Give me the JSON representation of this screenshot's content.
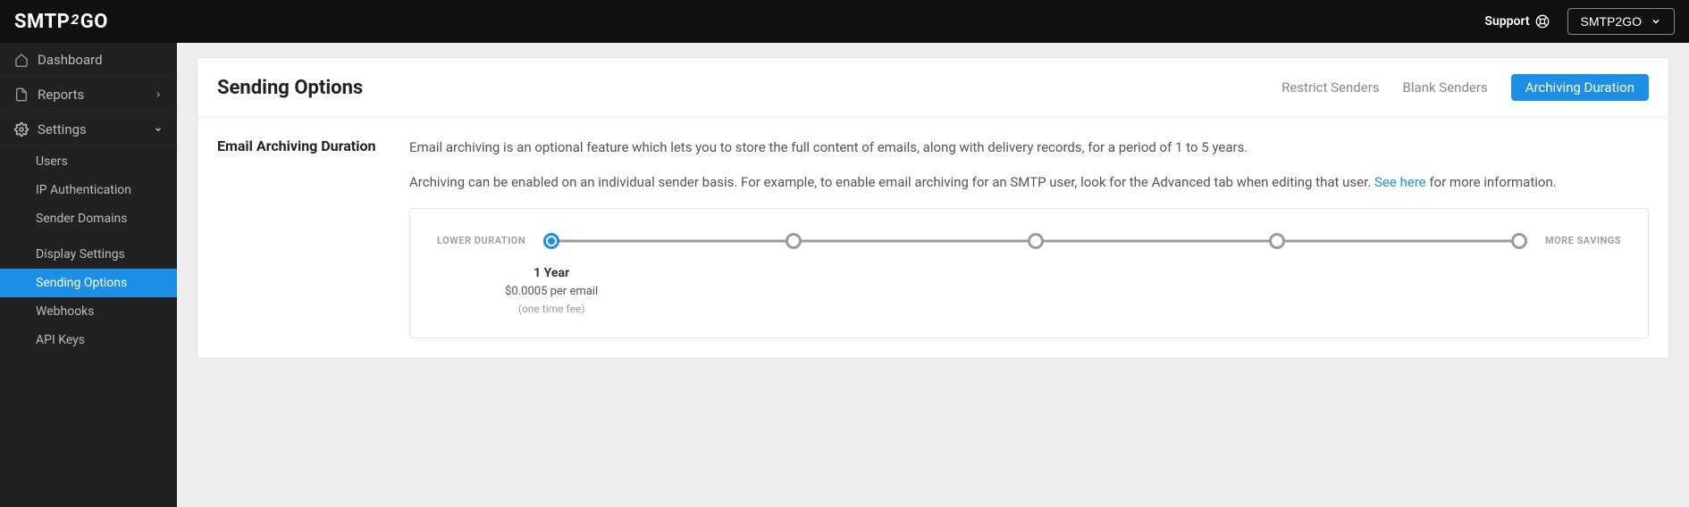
{
  "header": {
    "logo_prefix": "SMTP",
    "logo_mid": "2",
    "logo_suffix": "GO",
    "support_label": "Support",
    "account_label": "SMTP2GO"
  },
  "sidebar": {
    "items": [
      {
        "label": "Dashboard"
      },
      {
        "label": "Reports"
      },
      {
        "label": "Settings"
      }
    ],
    "settings_children_group1": [
      {
        "label": "Users"
      },
      {
        "label": "IP Authentication"
      },
      {
        "label": "Sender Domains"
      }
    ],
    "settings_children_group2": [
      {
        "label": "Display Settings"
      },
      {
        "label": "Sending Options"
      },
      {
        "label": "Webhooks"
      },
      {
        "label": "API Keys"
      }
    ]
  },
  "page": {
    "title": "Sending Options",
    "tabs": [
      {
        "label": "Restrict Senders"
      },
      {
        "label": "Blank Senders"
      },
      {
        "label": "Archiving Duration"
      }
    ],
    "section_title": "Email Archiving Duration",
    "desc1": "Email archiving is an optional feature which lets you to store the full content of emails, along with delivery records, for a period of 1 to 5 years.",
    "desc2_a": "Archiving can be enabled on an individual sender basis. For example, to enable email archiving for an SMTP user, look for the Advanced tab when editing that user. ",
    "desc2_link": "See here",
    "desc2_b": " for more information.",
    "slider": {
      "left_label": "LOWER DURATION",
      "right_label": "MORE SAVINGS",
      "num_stops": 5,
      "selected_index": 0,
      "value_title": "1 Year",
      "value_sub": "$0.0005 per email",
      "value_note": "(one time fee)"
    }
  }
}
